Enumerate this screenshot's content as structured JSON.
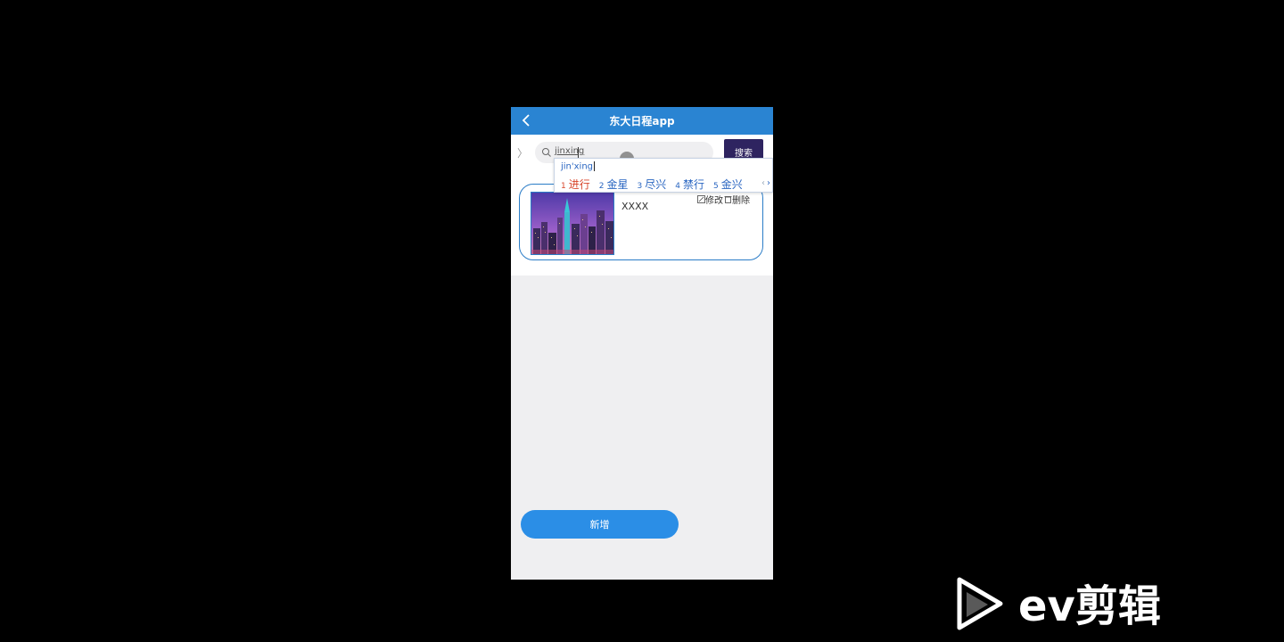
{
  "header": {
    "title": "东大日程app"
  },
  "search": {
    "value": "jinxing",
    "button_label": "搜索"
  },
  "ime": {
    "composition": "jin'xing",
    "candidates": [
      {
        "num": "1",
        "text": "进行"
      },
      {
        "num": "2",
        "text": "金星"
      },
      {
        "num": "3",
        "text": "尽兴"
      },
      {
        "num": "4",
        "text": "禁行"
      },
      {
        "num": "5",
        "text": "金兴"
      }
    ]
  },
  "list": {
    "items": [
      {
        "title": "XXXX",
        "edit_label": "修改",
        "delete_label": "删除"
      }
    ]
  },
  "footer": {
    "add_label": "新增"
  },
  "watermark": {
    "text": "ev剪辑"
  },
  "colors": {
    "header_bg": "#2a84d2",
    "search_button_bg": "#2e2460",
    "add_button_bg": "#2b8ee6",
    "card_border": "#2a7cc7",
    "ime_first_candidate": "#d8462b"
  }
}
